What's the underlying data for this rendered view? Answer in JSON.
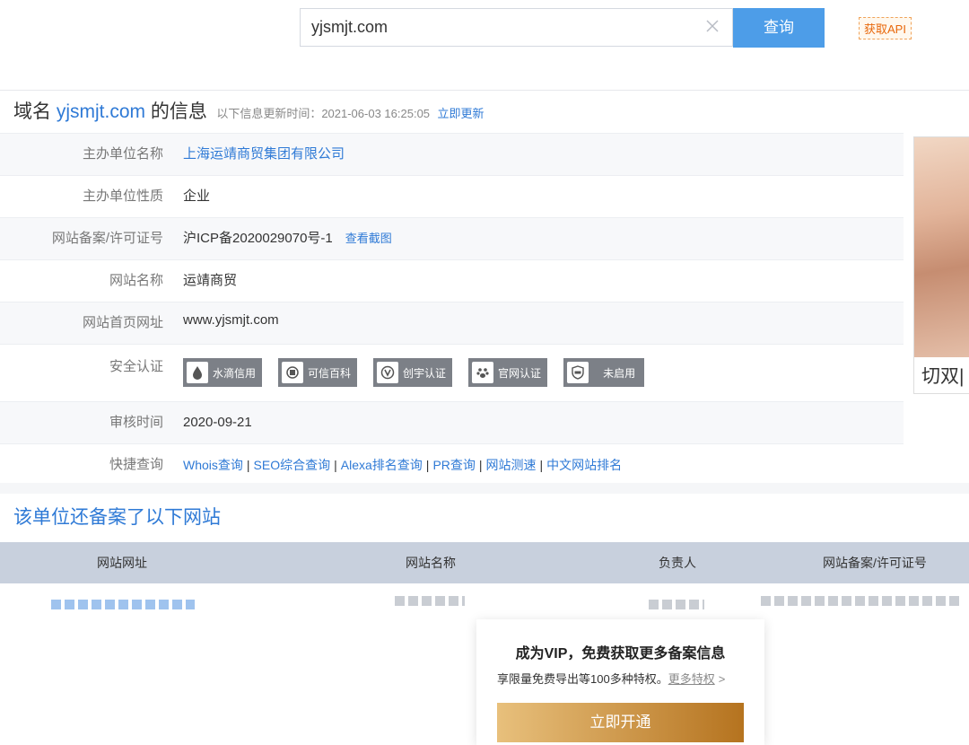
{
  "search": {
    "value": "yjsmjt.com",
    "button": "查询",
    "api_link": "获取API"
  },
  "header": {
    "prefix": "域名 ",
    "domain": "yjsmjt.com",
    "suffix": " 的信息",
    "update_text": "以下信息更新时间：2021-06-03 16:25:05",
    "update_link": "立即更新"
  },
  "info": {
    "company_label": "主办单位名称",
    "company_value": "上海运靖商贸集团有限公司",
    "nature_label": "主办单位性质",
    "nature_value": "企业",
    "icp_label": "网站备案/许可证号",
    "icp_value": "沪ICP备2020029070号-1",
    "icp_link": "查看截图",
    "site_name_label": "网站名称",
    "site_name_value": "运靖商贸",
    "homepage_label": "网站首页网址",
    "homepage_value": "www.yjsmjt.com",
    "security_label": "安全认证",
    "badges": [
      "水滴信用",
      "可信百科",
      "创宇认证",
      "官网认证",
      "未启用"
    ],
    "review_label": "审核时间",
    "review_value": "2020-09-21",
    "quick_label": "快捷查询",
    "quick_links": [
      "Whois查询",
      "SEO综合查询",
      "Alexa排名查询",
      "PR查询",
      "网站测速",
      "中文网站排名"
    ]
  },
  "ad": {
    "text": "切双|"
  },
  "sites": {
    "title": "该单位还备案了以下网站",
    "columns": [
      "网站网址",
      "网站名称",
      "负责人",
      "网站备案/许可证号"
    ]
  },
  "vip": {
    "title": "成为VIP，免费获取更多备案信息",
    "desc": "享限量免费导出等100多种特权。",
    "more": "更多特权",
    "button": "立即开通"
  },
  "colors": {
    "accent": "#2f7ad6",
    "search_button": "#4d9de8",
    "api": "#e8670a"
  }
}
